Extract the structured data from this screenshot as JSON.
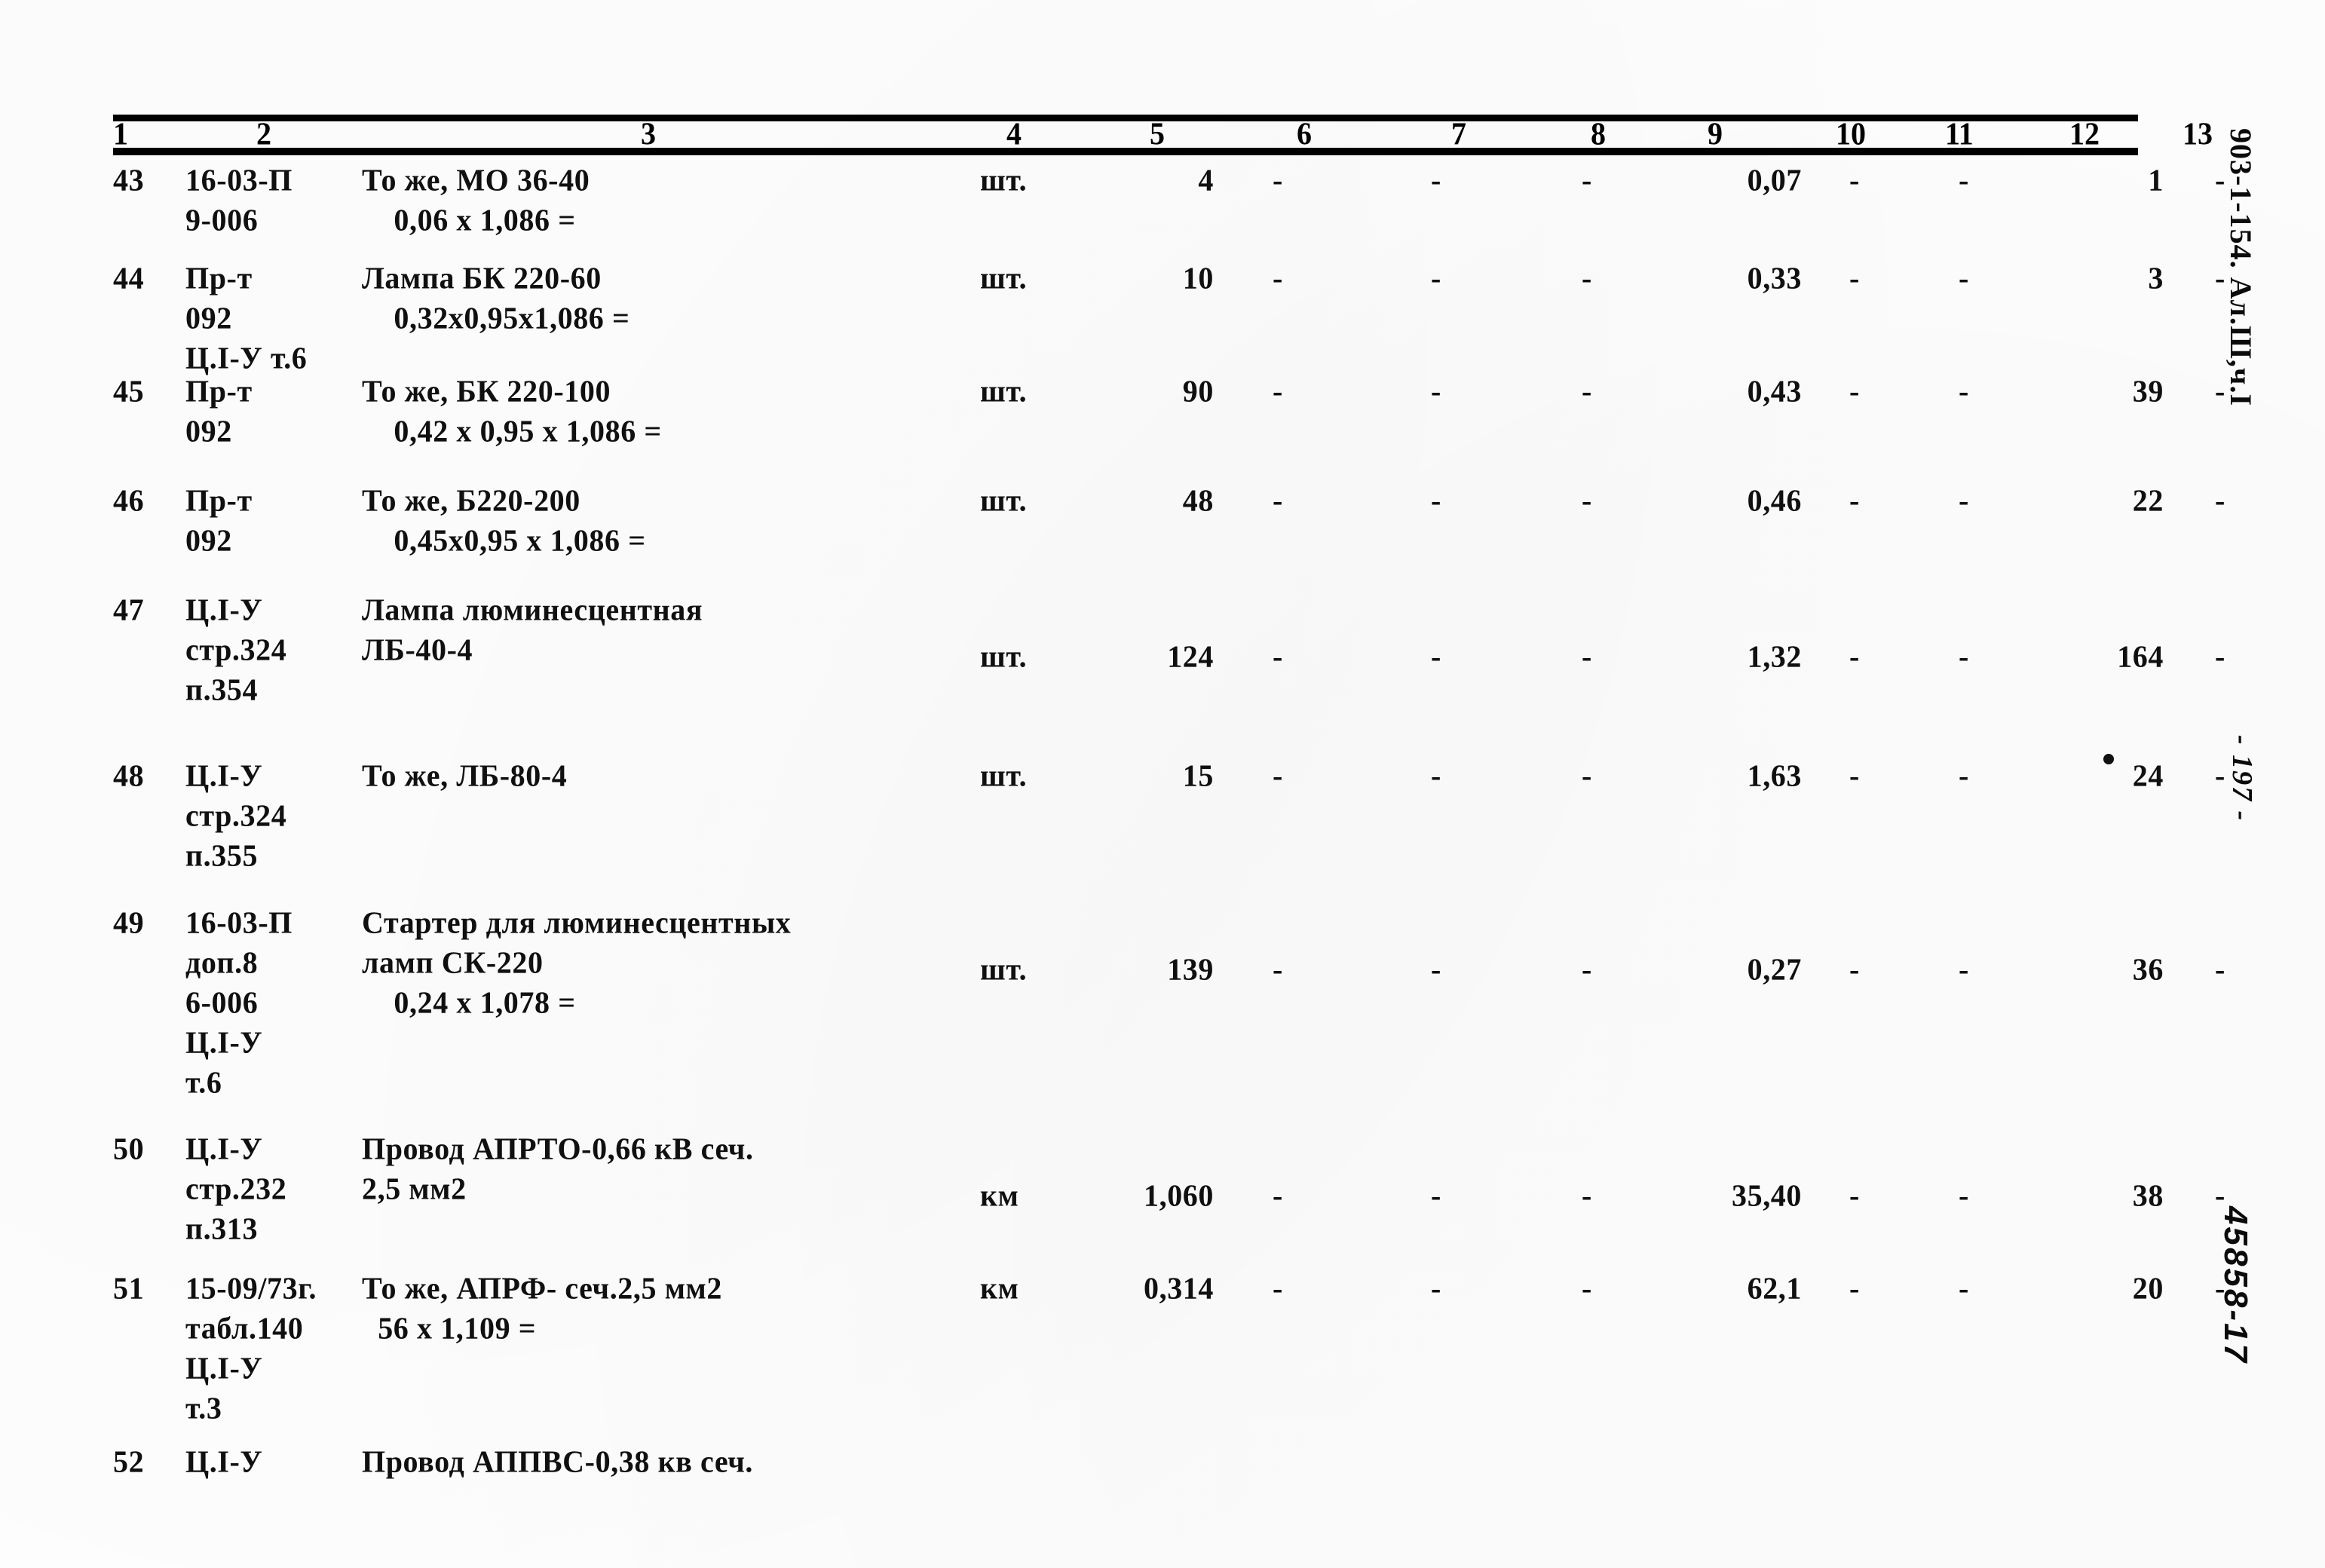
{
  "document": {
    "reference": "903-1-154. Ал.Ш,ч.I",
    "page_number": "- 197 -",
    "archive_stamp": "45858-17"
  },
  "table": {
    "column_numbers": [
      "1",
      "2",
      "3",
      "4",
      "5",
      "6",
      "7",
      "8",
      "9",
      "10",
      "11",
      "12",
      "13"
    ],
    "dash": "-",
    "rows": [
      {
        "num": "43",
        "code": "16-03-П\n9-006",
        "desc": "То же, МО 36-40\n    0,06 х 1,086 =",
        "unit": "шт.",
        "qty": "4",
        "c6": "-",
        "c7": "-",
        "c8": "-",
        "c9": "0,07",
        "c10": "-",
        "c11": "-",
        "c12": "1",
        "c13": "-"
      },
      {
        "num": "44",
        "code": "Пр-т\n092\nЦ.I-У т.6",
        "desc": "Лампа БК 220-60\n    0,32х0,95х1,086 =",
        "unit": "шт.",
        "qty": "10",
        "c6": "-",
        "c7": "-",
        "c8": "-",
        "c9": "0,33",
        "c10": "-",
        "c11": "-",
        "c12": "3",
        "c13": "-"
      },
      {
        "num": "45",
        "code": "Пр-т\n092",
        "desc": "То же, БК 220-100\n    0,42 х 0,95 х 1,086 =",
        "unit": "шт.",
        "qty": "90",
        "c6": "-",
        "c7": "-",
        "c8": "-",
        "c9": "0,43",
        "c10": "-",
        "c11": "-",
        "c12": "39",
        "c13": "-"
      },
      {
        "num": "46",
        "code": "Пр-т\n092",
        "desc": "То же, Б220-200\n    0,45х0,95 х 1,086 =",
        "unit": "шт.",
        "qty": "48",
        "c6": "-",
        "c7": "-",
        "c8": "-",
        "c9": "0,46",
        "c10": "-",
        "c11": "-",
        "c12": "22",
        "c13": "-"
      },
      {
        "num": "47",
        "code": "Ц.I-У\nстр.324\nп.354",
        "desc": "Лампа люминесцентная\nЛБ-40-4",
        "unit": "шт.",
        "qty": "124",
        "c6": "-",
        "c7": "-",
        "c8": "-",
        "c9": "1,32",
        "c10": "-",
        "c11": "-",
        "c12": "164",
        "c13": "-"
      },
      {
        "num": "48",
        "code": "Ц.I-У\nстр.324\nп.355",
        "desc": "То же, ЛБ-80-4",
        "unit": "шт.",
        "qty": "15",
        "c6": "-",
        "c7": "-",
        "c8": "-",
        "c9": "1,63",
        "c10": "-",
        "c11": "-",
        "c12": "24",
        "c13": "-"
      },
      {
        "num": "49",
        "code": "16-03-П\nдоп.8\n6-006\nЦ.I-У\nт.6",
        "desc": "Стартер для люминесцентных\nламп СК-220\n    0,24 х 1,078 =",
        "unit": "шт.",
        "qty": "139",
        "c6": "-",
        "c7": "-",
        "c8": "-",
        "c9": "0,27",
        "c10": "-",
        "c11": "-",
        "c12": "36",
        "c13": "-"
      },
      {
        "num": "50",
        "code": "Ц.I-У\nстр.232\nп.313",
        "desc": "Провод АПРТО-0,66 кВ сеч.\n2,5 мм2",
        "unit": "км",
        "qty": "1,060",
        "c6": "-",
        "c7": "-",
        "c8": "-",
        "c9": "35,40",
        "c10": "-",
        "c11": "-",
        "c12": "38",
        "c13": "-"
      },
      {
        "num": "51",
        "code": "15-09/73г.\nтабл.140\nЦ.I-У\nт.3",
        "desc": "То же, АПРФ- сеч.2,5 мм2\n  56 х 1,109 =",
        "unit": "км",
        "qty": "0,314",
        "c6": "-",
        "c7": "-",
        "c8": "-",
        "c9": "62,1",
        "c10": "-",
        "c11": "-",
        "c12": "20",
        "c13": "-"
      },
      {
        "num": "52",
        "code": "Ц.I-У",
        "desc": "Провод АППВС-0,38 кв сеч.",
        "unit": "",
        "qty": "",
        "c6": "",
        "c7": "",
        "c8": "",
        "c9": "",
        "c10": "",
        "c11": "",
        "c12": "",
        "c13": ""
      }
    ]
  }
}
